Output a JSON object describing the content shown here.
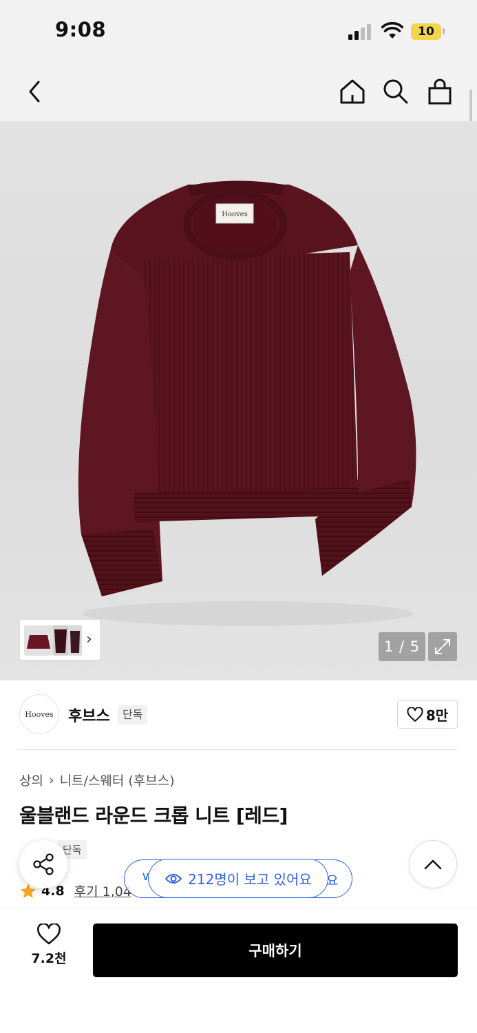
{
  "status_bar": {
    "time": "9:08",
    "battery": "10",
    "icons": [
      "cellular-signal-icon",
      "wifi-icon",
      "battery-icon"
    ]
  },
  "nav": {
    "icons": [
      "back-chevron-icon",
      "home-icon",
      "search-icon",
      "shopping-bag-icon"
    ]
  },
  "gallery": {
    "counter": "1 / 5",
    "current_image": 1,
    "total_images": 5,
    "product_color": "#5a1420",
    "icons": [
      "chevron-right-icon",
      "expand-icon"
    ]
  },
  "brand": {
    "logo_text": "Hooves",
    "name": "후브스",
    "badge": "단독",
    "follow_count": "8만",
    "icons": [
      "heart-outline-icon"
    ]
  },
  "product": {
    "breadcrumb": [
      "상의",
      "니트/스웨터 (후브스)"
    ],
    "title": "울블랜드 라운드 크롭 니트 [레드]",
    "tags": [
      "단독"
    ],
    "rating": "4.8",
    "review_link": "후기 1,04"
  },
  "floating": {
    "viewer_text": "212명이 보고 있어요",
    "viewer_back_left": "∨",
    "viewer_back_right": "요",
    "accent_color": "#2f62d8",
    "icons": [
      "share-icon",
      "chevron-up-icon",
      "eye-icon",
      "star-icon"
    ]
  },
  "bottom_bar": {
    "wish_count": "7.2천",
    "buy_label": "구매하기"
  }
}
